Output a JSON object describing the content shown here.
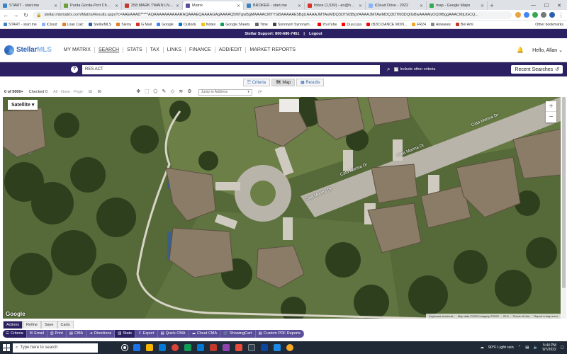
{
  "browser": {
    "tabs": [
      {
        "title": "START - start.me",
        "color": "#3b82c4",
        "active": false
      },
      {
        "title": "Punta Gorda-Port Charlott",
        "color": "#6a9f3a",
        "active": false
      },
      {
        "title": "258 MARK TWAIN LN | Ro",
        "color": "#c0392b",
        "active": false
      },
      {
        "title": "Matrix",
        "color": "#5b4e9a",
        "active": true
      },
      {
        "title": "BROKER - start.me",
        "color": "#3b82c4",
        "active": false
      },
      {
        "title": "Inbox (1,530) - an@home",
        "color": "#d93025",
        "active": false
      },
      {
        "title": "iCloud Drive - 2022",
        "color": "#8ab4f8",
        "active": false
      },
      {
        "title": "map - Google Maps",
        "color": "#34a853",
        "active": false
      }
    ],
    "new_tab": "+",
    "url": "stellar.mlsmatrix.com/Matrix/Results.aspx?c=AAEAAAD*****AQAAAAAAAAAARAQAAAEQAAAAGAgAAAAQ5MTgwBgMAAAACMTYGBAAAAAE5BgUAAAAJMTAwMDQ3OTM3BgYAAAAJMTAwMDQ3OTM3DQIGBwAAAAlyOQ0IBggAAACMjUGCQ...",
    "bookmarks": [
      {
        "label": "START - start.me",
        "color": "#3b82c4"
      },
      {
        "label": "iCloud",
        "color": "#8ab4f8"
      },
      {
        "label": "Loan Calc",
        "color": "#e67e22"
      },
      {
        "label": "StellarMLS",
        "color": "#2b5fb0"
      },
      {
        "label": "Sierra",
        "color": "#e67e22"
      },
      {
        "label": "G Mail",
        "color": "#d93025"
      },
      {
        "label": "Google",
        "color": "#4285f4"
      },
      {
        "label": "Outlook",
        "color": "#0078d4"
      },
      {
        "label": "Notes",
        "color": "#f4c20d"
      },
      {
        "label": "Google Sheets",
        "color": "#0f9d58"
      },
      {
        "label": "Time",
        "color": "#666666"
      },
      {
        "label": "Synonym Synonym...",
        "color": "#444444"
      },
      {
        "label": "YouTube",
        "color": "#ff0000"
      },
      {
        "label": "Dua Lipa",
        "color": "#ff0000"
      },
      {
        "label": "(B20) DANCE MON...",
        "color": "#ff0000"
      },
      {
        "label": "FR24",
        "color": "#f5a623"
      },
      {
        "label": "Airwaves",
        "color": "#888888"
      },
      {
        "label": "Bel Ami",
        "color": "#c0392b"
      }
    ],
    "other_bookmarks": "Other bookmarks"
  },
  "support": {
    "text": "Stellar Support: 800-686-7451",
    "logout": "Logout"
  },
  "nav": {
    "logo_a": "Stellar",
    "logo_b": "MLS",
    "items": [
      "MY MATRIX",
      "SEARCH",
      "STATS",
      "TAX",
      "LINKS",
      "FINANCE",
      "ADD/EDIT",
      "MARKET REPORTS"
    ],
    "greeting": "Hello, Allan"
  },
  "search": {
    "help": "?",
    "value": "RES ACT",
    "include_label": "Include other criteria",
    "recent_label": "Recent Searches"
  },
  "views": {
    "criteria": "Criteria",
    "map": "Map",
    "results": "Results"
  },
  "toolbar": {
    "count": "0 of 5000+",
    "checked": "Checked 0",
    "selector": "All - None - Page",
    "jump_placeholder": "Jump to Address"
  },
  "map": {
    "type_label": "Satellite",
    "zoom_in": "+",
    "zoom_out": "−",
    "street_names": [
      "Cata Marina Dr",
      "Cata Marina Dr",
      "Cata Marina Dr",
      "Cata Marina Dr"
    ],
    "google": "Google",
    "footer": [
      "Keyboard shortcuts",
      "Map data ©2022 Imagery ©2022",
      "20 ft",
      "Terms of Use",
      "Report a map error"
    ]
  },
  "actions": {
    "tabs": [
      "Actions",
      "Refine",
      "Save",
      "Carts"
    ],
    "buttons": [
      "Criteria",
      "Email",
      "Print",
      "CMA",
      "Directions",
      "Stats",
      "Export",
      "Quick CMA",
      "Cloud CMA",
      "ShowingCart",
      "Custom PDF Reports"
    ]
  },
  "taskbar": {
    "search_placeholder": "Type here to search",
    "weather": "90°F  Light rain",
    "time": "5:44 PM",
    "date": "9/7/2022"
  }
}
